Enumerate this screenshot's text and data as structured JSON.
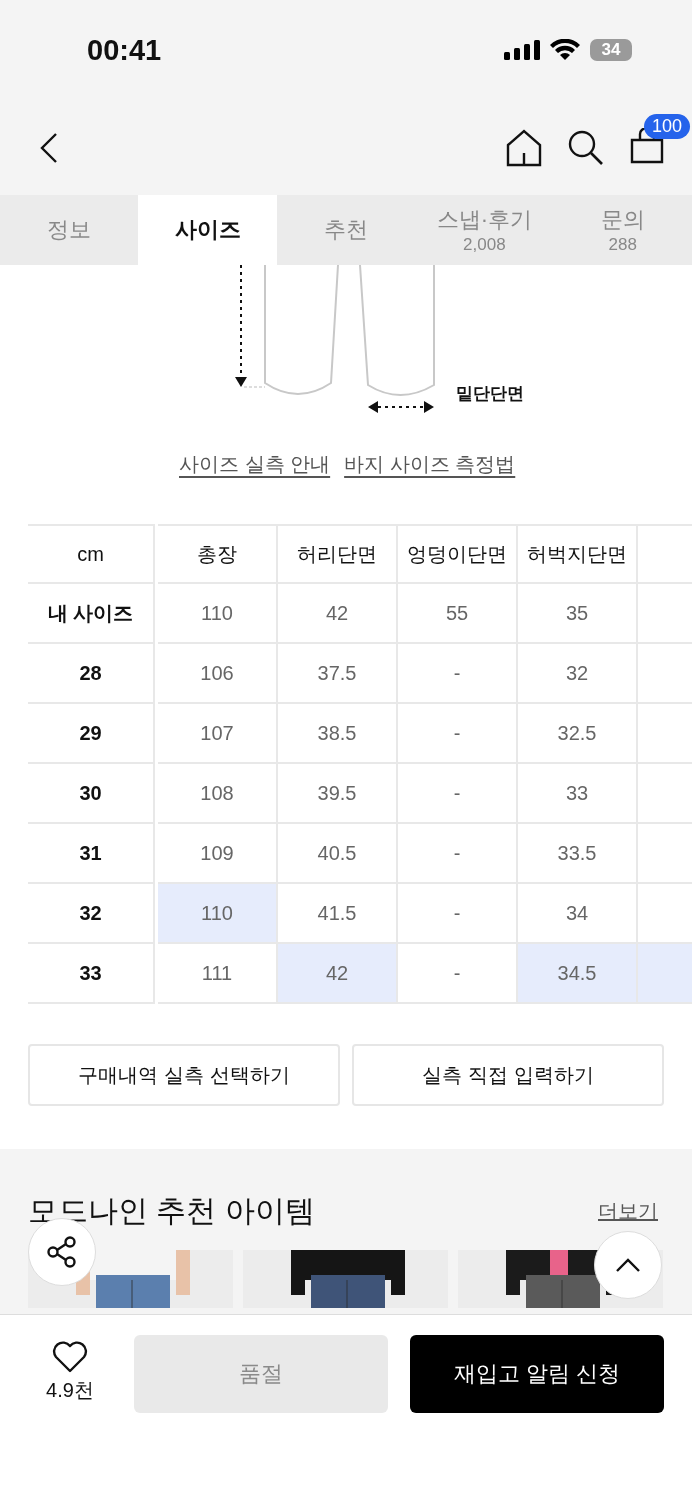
{
  "status_bar": {
    "time": "00:41",
    "battery": "34"
  },
  "header": {
    "cart_badge": "100"
  },
  "tabs": [
    {
      "label": "정보",
      "selected": false
    },
    {
      "label": "사이즈",
      "selected": true
    },
    {
      "label": "추천",
      "selected": false
    },
    {
      "label": "스냅·후기",
      "count": "2,008",
      "selected": false
    },
    {
      "label": "문의",
      "count": "288",
      "selected": false
    }
  ],
  "diagram": {
    "label": "밑단단면"
  },
  "links": [
    "사이즈 실측 안내",
    "바지 사이즈 측정법"
  ],
  "size_table": {
    "corner": "cm",
    "columns": [
      "총장",
      "허리단면",
      "엉덩이단면",
      "허벅지단면"
    ],
    "rows": [
      {
        "label": "내 사이즈",
        "cells": [
          {
            "text": "110",
            "highlighted": false
          },
          {
            "text": "42",
            "highlighted": false
          },
          {
            "text": "55",
            "highlighted": false
          },
          {
            "text": "35",
            "highlighted": false
          },
          {
            "highlighted": false
          }
        ]
      },
      {
        "label": "28",
        "cells": [
          {
            "text": "106",
            "highlighted": false
          },
          {
            "text": "37.5",
            "highlighted": false
          },
          {
            "text": "-",
            "highlighted": false
          },
          {
            "text": "32",
            "highlighted": false
          },
          {
            "highlighted": false
          }
        ]
      },
      {
        "label": "29",
        "cells": [
          {
            "text": "107",
            "highlighted": false
          },
          {
            "text": "38.5",
            "highlighted": false
          },
          {
            "text": "-",
            "highlighted": false
          },
          {
            "text": "32.5",
            "highlighted": false
          },
          {
            "highlighted": false
          }
        ]
      },
      {
        "label": "30",
        "cells": [
          {
            "text": "108",
            "highlighted": false
          },
          {
            "text": "39.5",
            "highlighted": false
          },
          {
            "text": "-",
            "highlighted": false
          },
          {
            "text": "33",
            "highlighted": false
          },
          {
            "highlighted": false
          }
        ]
      },
      {
        "label": "31",
        "cells": [
          {
            "text": "109",
            "highlighted": false
          },
          {
            "text": "40.5",
            "highlighted": false
          },
          {
            "text": "-",
            "highlighted": false
          },
          {
            "text": "33.5",
            "highlighted": false
          },
          {
            "highlighted": false
          }
        ]
      },
      {
        "label": "32",
        "cells": [
          {
            "text": "110",
            "highlighted": true
          },
          {
            "text": "41.5",
            "highlighted": false
          },
          {
            "text": "-",
            "highlighted": false
          },
          {
            "text": "34",
            "highlighted": false
          },
          {
            "highlighted": false
          }
        ]
      },
      {
        "label": "33",
        "cells": [
          {
            "text": "111",
            "highlighted": false
          },
          {
            "text": "42",
            "highlighted": true
          },
          {
            "text": "-",
            "highlighted": false
          },
          {
            "text": "34.5",
            "highlighted": true
          },
          {
            "highlighted": true
          }
        ]
      }
    ]
  },
  "actions": [
    "구매내역 실측 선택하기",
    "실측 직접 입력하기"
  ],
  "recommend": {
    "title": "모드나인 추천 아이템",
    "more": "더보기"
  },
  "bottom_bar": {
    "likes": "4.9천",
    "sold_out": {
      "label": "품절",
      "disabled": true
    },
    "restock": "재입고 알림 신청"
  }
}
